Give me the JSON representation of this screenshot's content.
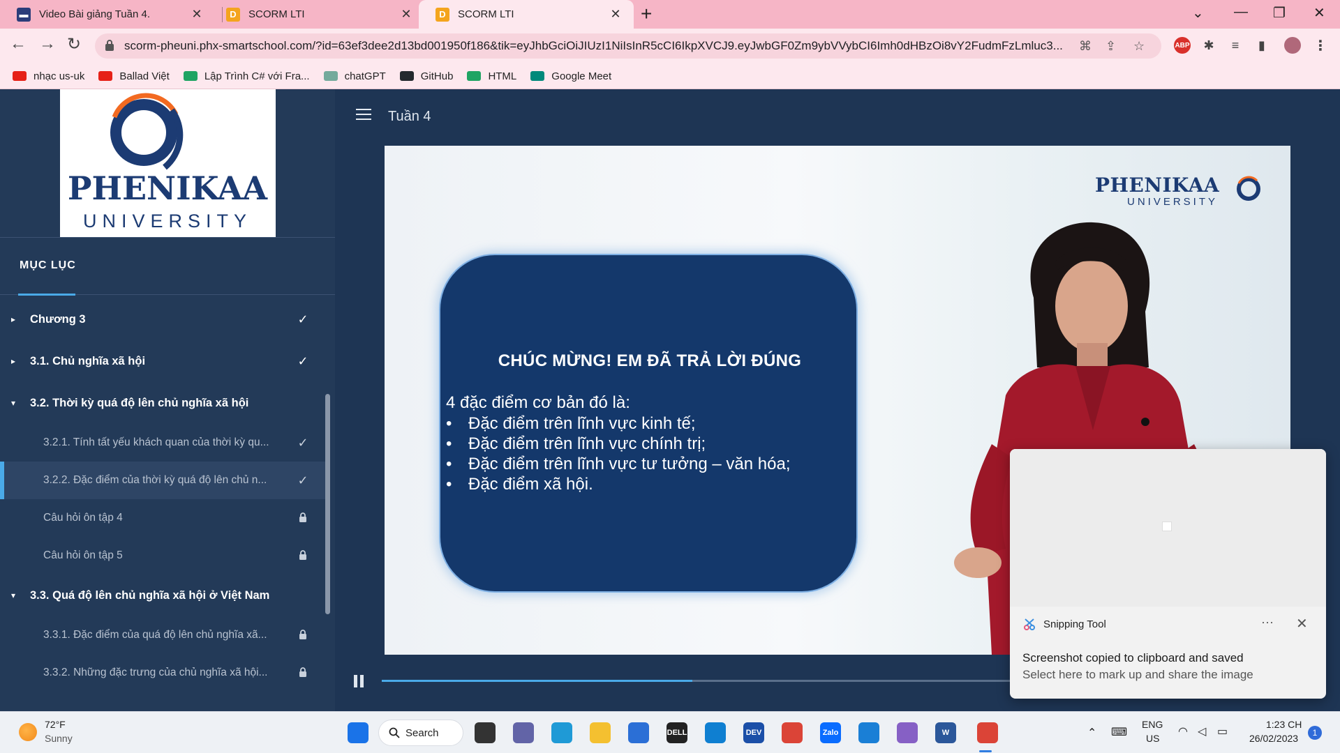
{
  "browser": {
    "tabs": [
      {
        "title": "Video Bài giảng Tuần 4.",
        "icon": "lms-icon",
        "close": "✕"
      },
      {
        "title": "SCORM LTI",
        "icon": "d-icon",
        "close": "✕"
      },
      {
        "title": "SCORM LTI",
        "icon": "d-icon",
        "close": "✕",
        "active": true
      }
    ],
    "new_tab": "+",
    "url": "scorm-pheuni.phx-smartschool.com/?id=63ef3dee2d13bd001950f186&tik=eyJhbGciOiJIUzI1NiIsInR5cCI6IkpXVCJ9.eyJwbGF0Zm9ybVVybCI6Imh0dHBzOi8vY2FudmFzLmluc3...",
    "bookmarks": [
      {
        "label": "nhạc us-uk",
        "color": "#e62117"
      },
      {
        "label": "Ballad Việt",
        "color": "#e62117"
      },
      {
        "label": "Lập Trình C# với Fra...",
        "color": "#1fa463"
      },
      {
        "label": "chatGPT",
        "color": "#74aa9c"
      },
      {
        "label": "GitHub",
        "color": "#24292e"
      },
      {
        "label": "HTML",
        "color": "#1fa463"
      },
      {
        "label": "Google Meet",
        "color": "#00897b"
      }
    ],
    "ext_abp": "ABP"
  },
  "sidebar": {
    "logo_word": "PHENIKAA",
    "logo_sub": "UNIVERSITY",
    "toc_heading": "MỤC LỤC",
    "items": [
      {
        "text": "Chương 3",
        "level": "chapter",
        "arrow": "▸",
        "status": "✓"
      },
      {
        "text": "3.1. Chủ nghĩa xã hội",
        "level": "chapter",
        "arrow": "▸",
        "status": "✓"
      },
      {
        "text": "3.2. Thời kỳ quá độ lên chủ nghĩa xã hội",
        "level": "chapter",
        "arrow": "▾",
        "status": ""
      },
      {
        "text": "3.2.1. Tính tất yếu khách quan của thời kỳ qu...",
        "level": "lesson",
        "status": "✓"
      },
      {
        "text": "3.2.2. Đặc điểm của thời kỳ quá độ lên chủ n...",
        "level": "lesson",
        "status": "✓",
        "current": true
      },
      {
        "text": "Câu hỏi ôn tập 4",
        "level": "lesson",
        "status": "lock"
      },
      {
        "text": "Câu hỏi ôn tập 5",
        "level": "lesson",
        "status": "lock"
      },
      {
        "text": "3.3. Quá độ lên chủ nghĩa xã hội ở Việt Nam",
        "level": "chapter",
        "arrow": "▾",
        "status": ""
      },
      {
        "text": "3.3.1. Đặc điểm của quá độ lên chủ nghĩa xã...",
        "level": "lesson",
        "status": "lock"
      },
      {
        "text": "3.3.2. Những đặc trưng của chủ nghĩa xã hội...",
        "level": "lesson",
        "status": "lock"
      }
    ]
  },
  "main": {
    "page_title": "Tuần 4",
    "video": {
      "logo_word": "PHENIKAA",
      "logo_sub": "UNIVERSITY",
      "card_title": "CHÚC MỪNG! EM ĐÃ TRẢ LỜI ĐÚNG",
      "card_intro": "4 đặc điểm cơ bản đó là:",
      "card_points": [
        "Đặc điểm trên lĩnh vực kinh tế;",
        "Đặc điểm trên lĩnh vực chính trị;",
        "Đặc điểm trên lĩnh vực tư tưởng – văn hóa;",
        "Đặc điểm xã hội."
      ],
      "progress_fraction": 0.445,
      "state": "playing"
    }
  },
  "toast": {
    "app": "Snipping Tool",
    "more": "···",
    "close": "✕",
    "title": "Screenshot copied to clipboard and saved",
    "body": "Select here to mark up and share the image"
  },
  "taskbar": {
    "weather_temp": "72°F",
    "weather_desc": "Sunny",
    "search_label": "Search",
    "apps": [
      {
        "name": "start",
        "color": "#1a73e8",
        "label": ""
      },
      {
        "name": "task-view",
        "color": "#333",
        "label": ""
      },
      {
        "name": "teams",
        "color": "#6264a7",
        "label": ""
      },
      {
        "name": "edge",
        "color": "#1f9ad6",
        "label": ""
      },
      {
        "name": "explorer",
        "color": "#f4c030",
        "label": ""
      },
      {
        "name": "store",
        "color": "#2b6fd6",
        "label": ""
      },
      {
        "name": "dell",
        "color": "#222",
        "label": "DELL"
      },
      {
        "name": "cortana",
        "color": "#0f7fd1",
        "label": ""
      },
      {
        "name": "devhome",
        "color": "#1b4fa8",
        "label": "DEV"
      },
      {
        "name": "chrome",
        "color": "#db4437",
        "label": ""
      },
      {
        "name": "zalo",
        "color": "#0a6cff",
        "label": "Zalo"
      },
      {
        "name": "vscode",
        "color": "#1a7fd6",
        "label": ""
      },
      {
        "name": "visual-studio",
        "color": "#8660c5",
        "label": ""
      },
      {
        "name": "word",
        "color": "#2b579a",
        "label": "W"
      },
      {
        "name": "chrome-active",
        "color": "#db4437",
        "label": ""
      }
    ],
    "lang_top": "ENG",
    "lang_bottom": "US",
    "time": "1:23 CH",
    "date": "26/02/2023",
    "notifications": "1"
  }
}
